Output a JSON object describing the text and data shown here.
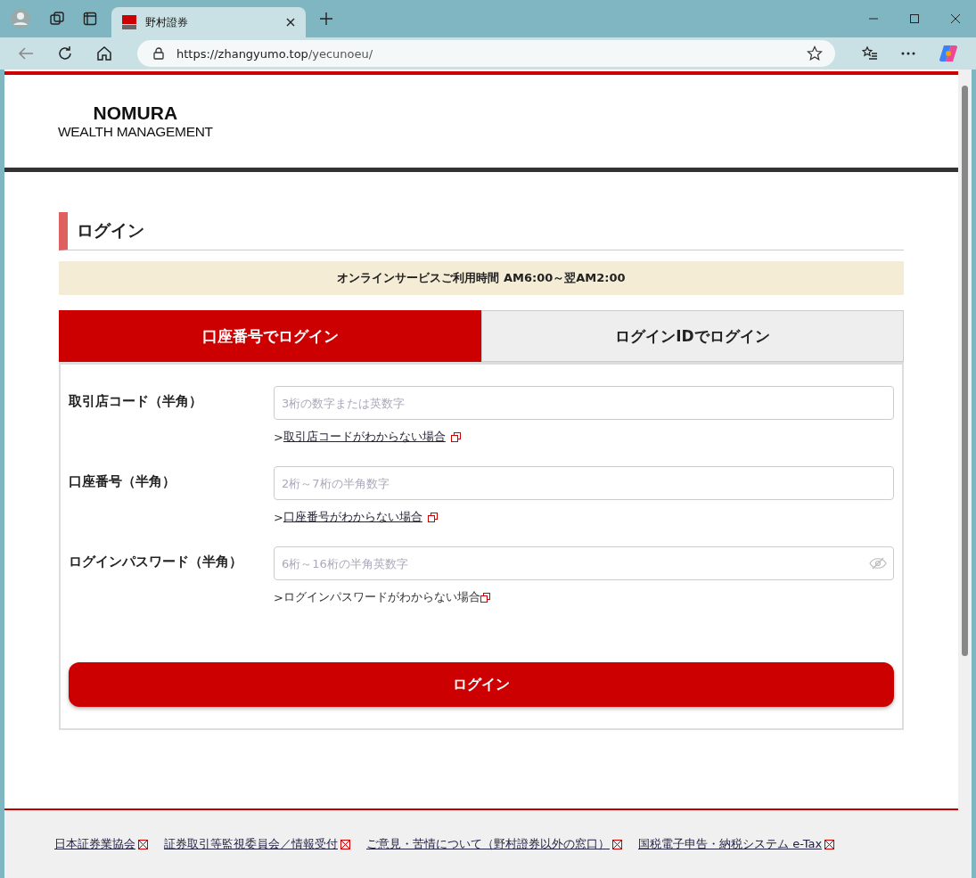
{
  "browser": {
    "tab_title": "野村證券",
    "url_host": "https://zhangyumo.top",
    "url_path": "/yecunoeu/"
  },
  "logo": {
    "line_1": "NOMURA",
    "line_2": "WEALTH MANAGEMENT"
  },
  "heading": "ログイン",
  "notice": "オンラインサービスご利用時間 AM6:00～翌AM2:00",
  "tabs": [
    {
      "label": "口座番号でログイン",
      "selected": true
    },
    {
      "label": "ログインIDでログイン",
      "selected": false
    }
  ],
  "fields": [
    {
      "label": "取引店コード（半角）",
      "placeholder": "3桁の数字または英数字",
      "help_prefix": ">",
      "help": "取引店コードがわからない場合",
      "underlined": true,
      "kind": "text"
    },
    {
      "label": "口座番号（半角）",
      "placeholder": "2桁～7桁の半角数字",
      "help_prefix": ">",
      "help": "口座番号がわからない場合",
      "underlined": true,
      "kind": "text"
    },
    {
      "label": "ログインパスワード（半角）",
      "placeholder": "6桁～16桁の半角英数字",
      "help_prefix": ">",
      "help": "ログインパスワードがわからない場合",
      "underlined": false,
      "kind": "password"
    }
  ],
  "submit": "ログイン",
  "footer_links": [
    "日本証券業協会",
    "証券取引等監視委員会／情報受付",
    "ご意見・苦情について（野村證券以外の窓口）",
    "国税電子申告・納税システム e-Tax"
  ]
}
